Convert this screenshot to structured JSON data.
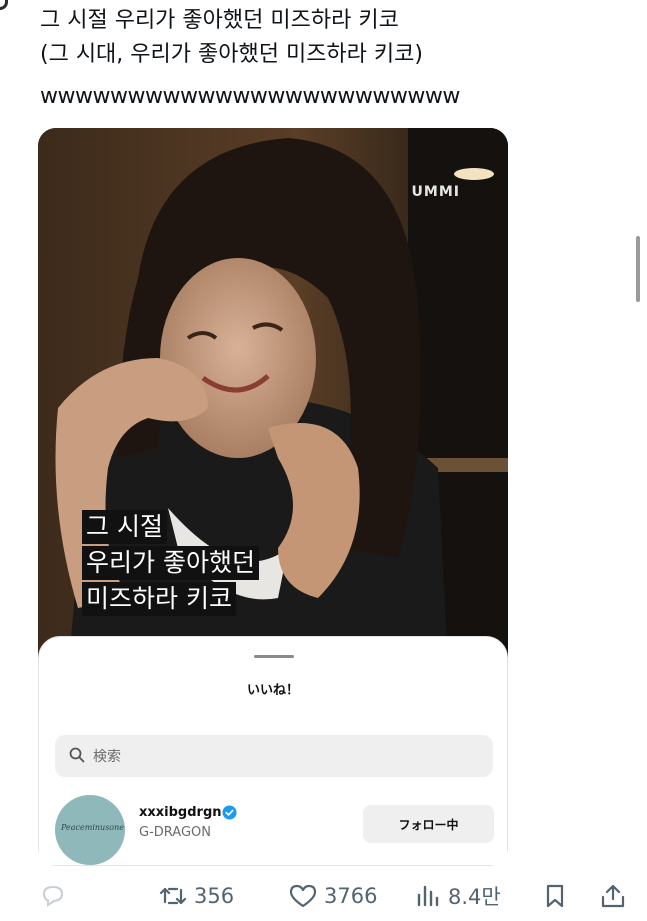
{
  "tweet": {
    "line1": "그 시절 우리가 좋아했던 미즈하라 키코",
    "line2": "(그 시대, 우리가 좋아했던 미즈하라 키코)",
    "line3": "wwwwwwwwwwwwwwwwwwwwwwww"
  },
  "media": {
    "watermark": "UMMI",
    "caption": [
      "그 시절",
      "우리가 좋아했던",
      "미즈하라 키코"
    ]
  },
  "likes_sheet": {
    "title": "いいね！",
    "search_placeholder": "検索",
    "user": {
      "handle": "xxxibgdrgn",
      "name": "G-DRAGON",
      "follow_label": "フォロー中",
      "avatar_text": "Peaceminusone"
    }
  },
  "actions": {
    "retweets": "356",
    "likes": "3766",
    "views": "8.4만"
  },
  "colors": {
    "verified": "#1d9bf0",
    "action_gray": "#536471"
  }
}
